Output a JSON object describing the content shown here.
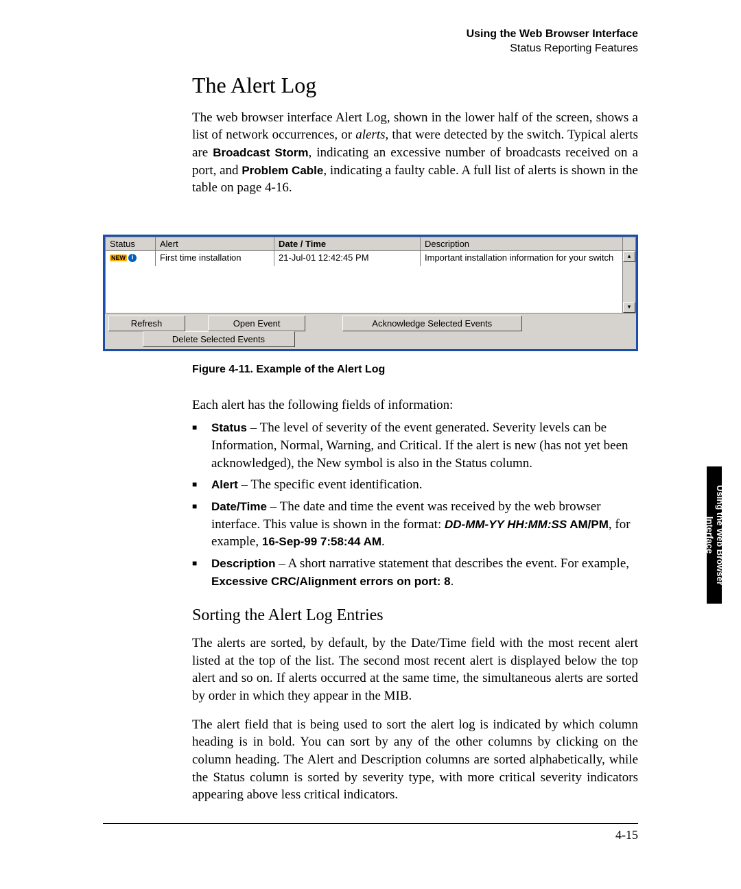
{
  "header": {
    "line1": "Using the Web Browser Interface",
    "line2": "Status Reporting Features"
  },
  "h1": "The Alert Log",
  "intro_pre": "The web browser interface Alert Log, shown in the lower half of the screen, shows a list of network occurrences, or ",
  "intro_em": "alerts",
  "intro_mid1": ", that were detected by the switch. Typical alerts are ",
  "intro_b1": "Broadcast Storm",
  "intro_mid2": ", indicating an excessive number of broadcasts received on a port, and ",
  "intro_b2": "Problem Cable",
  "intro_post": ", indicating a faulty cable. A full list of alerts is shown in the table on page 4-16.",
  "figure": {
    "headers": {
      "status": "Status",
      "alert": "Alert",
      "datetime": "Date / Time",
      "description": "Description"
    },
    "row": {
      "status_new": "NEW",
      "status_info": "i",
      "alert": "First time installation",
      "datetime": "21-Jul-01 12:42:45 PM",
      "description": "Important installation information for your switch"
    },
    "buttons": {
      "refresh": "Refresh",
      "open": "Open Event",
      "ack": "Acknowledge Selected Events",
      "del": "Delete Selected Events"
    }
  },
  "caption": "Figure 4-11.  Example of the Alert Log",
  "fields_intro": "Each alert has the following fields of information:",
  "field1_t": "Status",
  "field1_b": " – The level of severity of the event generated. Severity levels can be Information, Normal, Warning, and Critical. If the alert is new (has not yet been acknowledged), the New symbol is also in the Status column.",
  "field2_t": "Alert",
  "field2_b": " – The specific event identification.",
  "field3_t": "Date/Time",
  "field3_b1": " – The date and time the event was received by the web browser interface. This value is shown in the format: ",
  "field3_fmt": "DD-MM-YY HH:MM:SS",
  "field3_ampm": " AM/PM",
  "field3_ex_lead": ", for example, ",
  "field3_ex": "16-Sep-99 7:58:44 AM",
  "field3_tail": ".",
  "field4_t": "Description",
  "field4_b1": " – A short narrative statement that describes the event. For example, ",
  "field4_ex": "Excessive CRC/Alignment errors on port: 8",
  "field4_tail": ".",
  "h2": "Sorting the Alert Log Entries",
  "sort_p1": "The alerts are sorted, by default, by the Date/Time field with the most recent alert listed at the top of the list. The second most recent alert is displayed below the top alert and so on. If alerts occurred at the same time, the simultaneous alerts are sorted by order in which they appear in the MIB.",
  "sort_p2": "The alert field that is being used to sort the alert log is indicated by which column heading is in bold. You can sort by any of the other columns by clicking on the column heading. The Alert and Description columns are sorted alpha­betically, while the Status column is sorted by severity type, with more critical severity indicators appearing above less critical indicators.",
  "side_tab_l1": "Using the Web Browser",
  "side_tab_l2": "Interface",
  "page_number": "4-15"
}
